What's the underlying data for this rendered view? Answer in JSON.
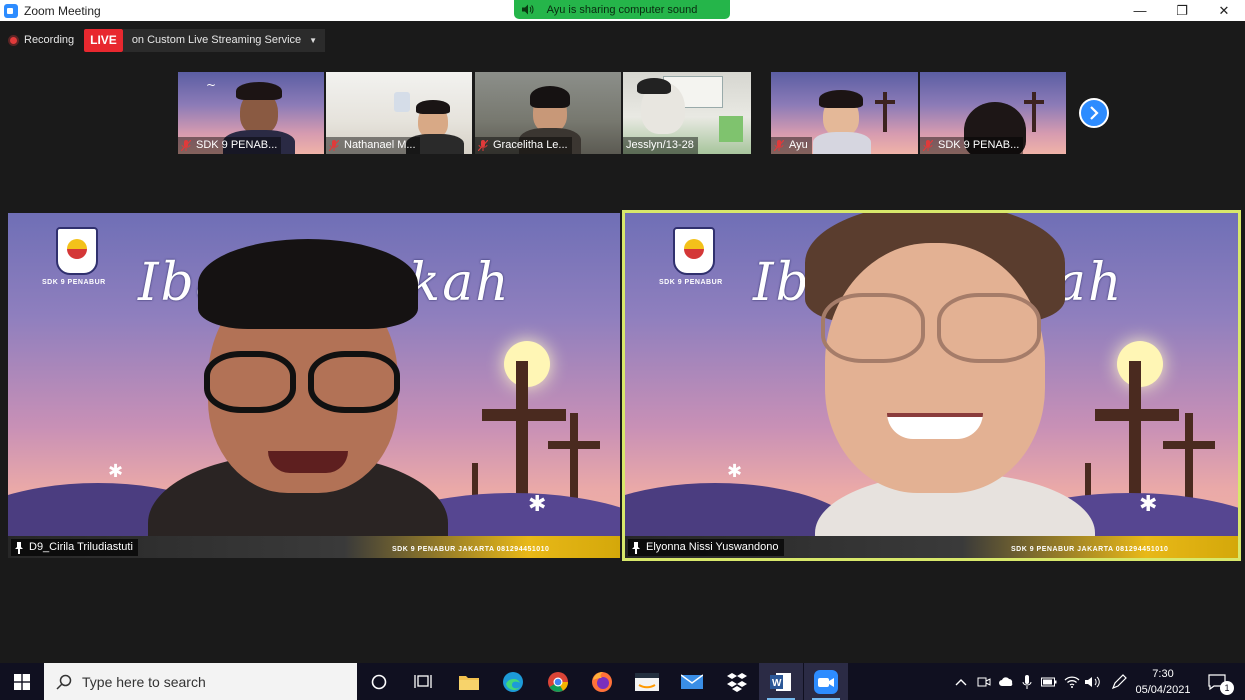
{
  "window": {
    "title": "Zoom Meeting",
    "minimize_glyph": "—",
    "maximize_glyph": "❐",
    "close_glyph": "✕"
  },
  "sharing_banner": "Ayu is sharing computer sound",
  "recording": {
    "label": "Recording",
    "live_badge": "LIVE",
    "service": "on Custom Live Streaming Service"
  },
  "thumbnails": [
    {
      "name": "SDK 9 PENAB..."
    },
    {
      "name": "Nathanael M..."
    },
    {
      "name": "Gracelitha Le..."
    },
    {
      "name": "Jesslyn/13-28"
    },
    {
      "name": "Ayu"
    },
    {
      "name": "SDK 9 PENAB..."
    }
  ],
  "videos": [
    {
      "name": "D9_Cirila Triludiastuti",
      "title_left": "Iba",
      "title_right": "skah",
      "school": "SDK 9 PENABUR",
      "footer": "SDK 9 PENABUR JAKARTA  081294451010"
    },
    {
      "name": "Elyonna Nissi Yuswandono",
      "title_left": "Ib",
      "title_right": "ah",
      "school": "SDK 9 PENABUR",
      "footer": "SDK 9 PENABUR JAKARTA  081294451010"
    }
  ],
  "taskbar": {
    "search_placeholder": "Type here to search",
    "time": "7:30",
    "date": "05/04/2021",
    "notification_count": "1"
  },
  "colors": {
    "accent": "#2d8cff",
    "live": "#e8282f",
    "banner": "#25b54a",
    "active_speaker": "#d8e86b"
  }
}
